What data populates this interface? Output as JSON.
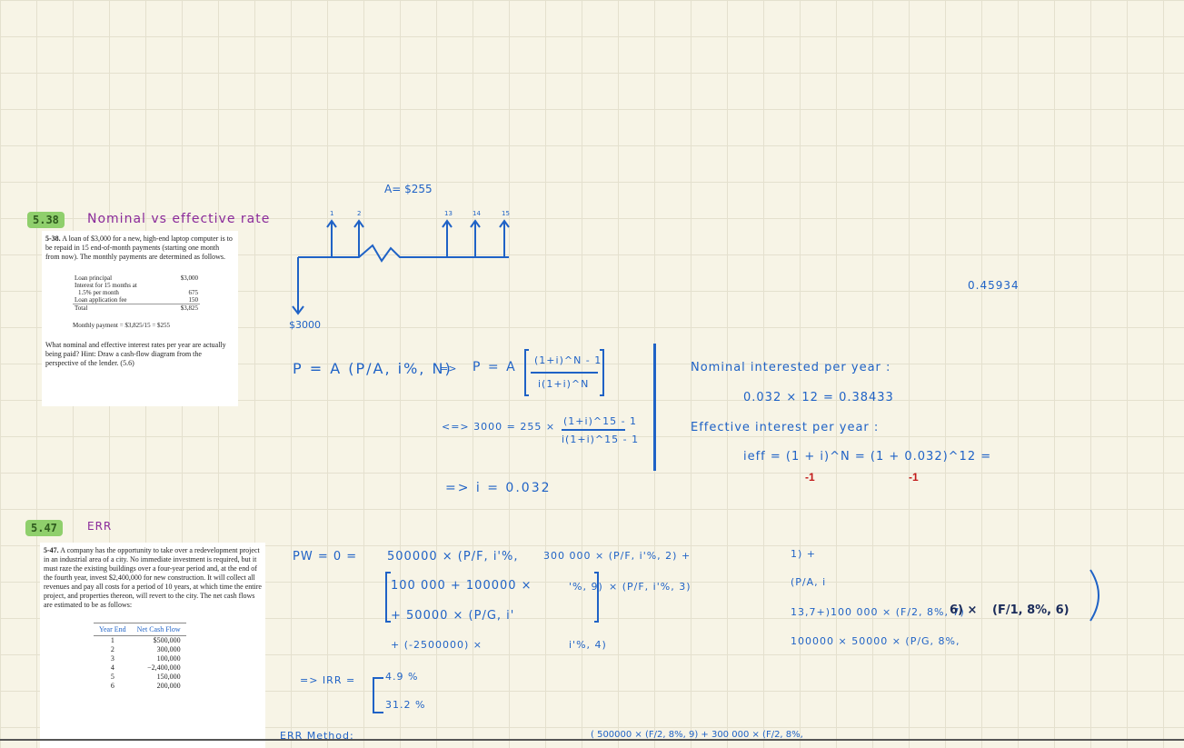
{
  "problem_538": {
    "badge": "5.38",
    "topic": "Nominal vs effective rate",
    "card_title": "5-38.",
    "card_text": "A loan of $3,000 for a new, high-end laptop computer is to be repaid in 15 end-of-month payments (starting one month from now). The monthly payments are determined as follows.",
    "table": [
      {
        "label": "Loan principal",
        "value": "$3,000"
      },
      {
        "label": "Interest for 15 months at",
        "value": ""
      },
      {
        "label": "1.5% per month",
        "value": "675"
      },
      {
        "label": "Loan application fee",
        "value": "150"
      },
      {
        "label": "Total",
        "value": "$3,825"
      }
    ],
    "monthly": "Monthly payment = $3,825/15 = $255",
    "question": "What nominal and effective interest rates per year are actually being paid? Hint: Draw a cash-flow diagram from the perspective of the lender. (5.6)"
  },
  "cashflow_diagram": {
    "annuity_label": "A= $255",
    "period_labels": [
      "1",
      "2",
      "13",
      "14",
      "15"
    ],
    "outflow_label": "$3000"
  },
  "stray_number": "0.45934",
  "notes_538": {
    "eq1_left": "P = A (P/A, i%, N)",
    "eq1_arrow": "=>",
    "eq1_right_P": "P = A",
    "eq1_num": "(1+i)^N - 1",
    "eq1_den": "i(1+i)^N",
    "eq2_prefix": "<=> 3000 = 255 ×",
    "eq2_num": "(1+i)^15 - 1",
    "eq2_den": "i(1+i)^15 - 1",
    "eq3": "=> i = 0.032",
    "nominal_title": "Nominal interested per year :",
    "nominal_calc": "0.032 × 12 = 0.38433",
    "effective_title": "Effective interest per year :",
    "effective_calc": "ieff = (1 + i)^N = (1 + 0.032)^12 =",
    "minus_one_a": "-1",
    "minus_one_b": "-1"
  },
  "problem_547": {
    "badge": "5.47",
    "topic": "ERR",
    "card_title": "5-47.",
    "card_text": "A company has the opportunity to take over a redevelopment project in an industrial area of a city. No immediate investment is required, but it must raze the existing buildings over a four-year period and, at the end of the fourth year, invest $2,400,000 for new construction. It will collect all revenues and pay all costs for a period of 10 years, at which time the entire project, and properties thereon, will revert to the city. The net cash flows are estimated to be as follows:",
    "table_headers": [
      "Year End",
      "Net Cash Flow"
    ],
    "table_rows": [
      {
        "year": "1",
        "flow": "$500,000"
      },
      {
        "year": "2",
        "flow": "300,000"
      },
      {
        "year": "3",
        "flow": "100,000"
      },
      {
        "year": "4",
        "flow": "−2,400,000"
      },
      {
        "year": "5",
        "flow": "150,000"
      },
      {
        "year": "6",
        "flow": "200,000"
      }
    ]
  },
  "notes_547": {
    "pw": "PW = 0 =",
    "t1": "500000 × (P/F, i'%,",
    "t2": "300 000 × (P/F, i'%, 2) +",
    "t3": "100 000 + 100000 ×",
    "t4": "'%, 9)",
    "t5": "× (P/F, i'%, 3)",
    "t6": "+ 50000 × (P/G, i'",
    "t7": "+ (-2500000) ×",
    "t8": "i'%, 4)",
    "r1": "1) +",
    "r2": "(P/A, i",
    "r3": "13,7+)100 000 × (F/2, 8%, 7)",
    "r3b": "6) ×",
    "r3c": "(F/1, 8%, 6)",
    "r4": "100000 × 50000 × (P/G, 8%,",
    "irr_label": "=> IRR =",
    "irr1": "4.9 %",
    "irr2": "31.2 %",
    "err_label": "ERR Method:",
    "err_formula": "( 500000 × (F/2, 8%, 9) + 300 000 × (F/2, 8%,"
  }
}
